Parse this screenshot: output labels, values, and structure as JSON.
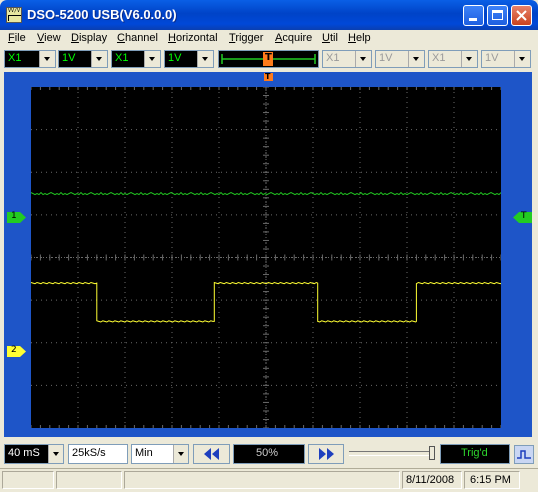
{
  "window": {
    "title": "DSO-5200 USB(V6.0.0.0)",
    "icon_label": "VV/V"
  },
  "menu": [
    "File",
    "View",
    "Display",
    "Channel",
    "Horizontal",
    "Trigger",
    "Acquire",
    "Util",
    "Help"
  ],
  "toolbar": {
    "ch1_probe": "X1",
    "ch1_volts": "1V",
    "ch2_probe": "X1",
    "ch2_volts": "1V",
    "ch3_probe": "X1",
    "ch3_volts": "1V",
    "ch4_probe": "X1",
    "ch4_volts": "1V",
    "trigger_position_marker": "T"
  },
  "scope": {
    "ch1_marker": "1",
    "ch2_marker": "2",
    "trigger_level_marker": "T",
    "colors": {
      "ch1": "#22cc22",
      "ch2": "#ffff33",
      "grid": "#6a6a6a",
      "frame": "#1e55c8"
    },
    "ch1_trace_level_div": 1.5,
    "ch2_low_div": -1.5,
    "ch2_high_div": -0.6,
    "ch2_edges_div": [
      -3.85,
      -0.6,
      0.6,
      3.1,
      4.3,
      7.2
    ]
  },
  "bottom": {
    "timebase": "40 mS",
    "sample_rate": "25kS/s",
    "acq_mode": "Min",
    "horizontal_position": "50%",
    "trigger_status": "Trig'd"
  },
  "status": {
    "date": "8/11/2008",
    "time": "6:15 PM"
  }
}
